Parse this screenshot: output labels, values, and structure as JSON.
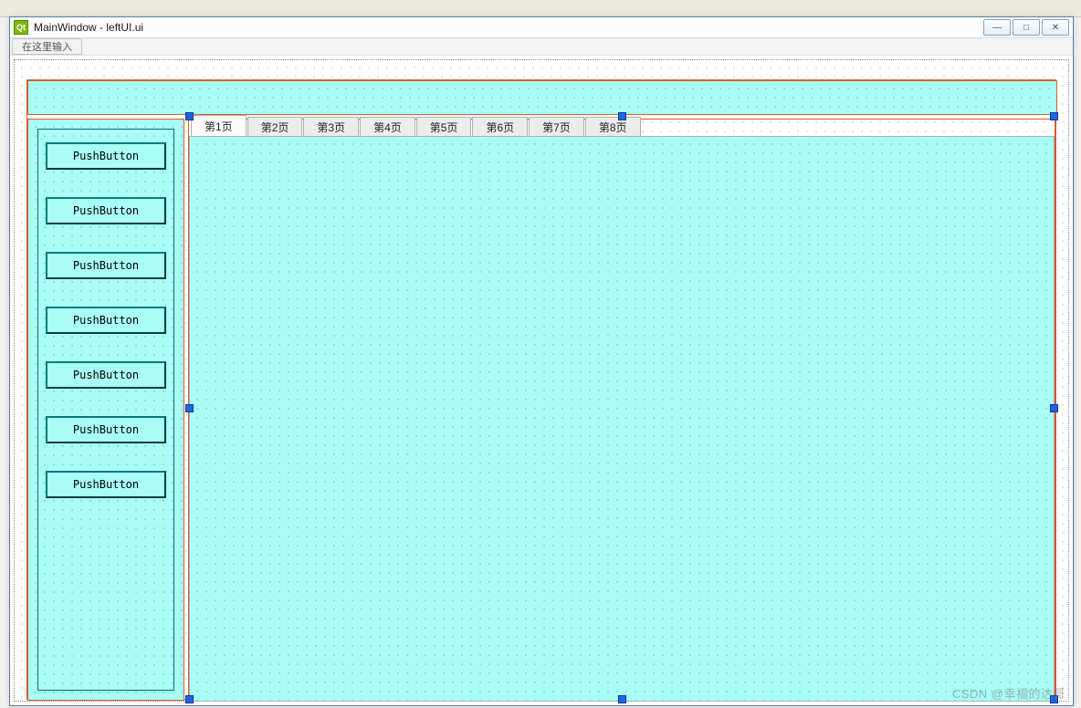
{
  "window": {
    "title": "MainWindow - leftUI.ui",
    "icon_label": "Qt",
    "minimize_glyph": "—",
    "maximize_glyph": "□",
    "close_glyph": "✕"
  },
  "menu": {
    "placeholder": "在这里输入"
  },
  "sidebar": {
    "buttons": [
      {
        "label": "PushButton"
      },
      {
        "label": "PushButton"
      },
      {
        "label": "PushButton"
      },
      {
        "label": "PushButton"
      },
      {
        "label": "PushButton"
      },
      {
        "label": "PushButton"
      },
      {
        "label": "PushButton"
      }
    ]
  },
  "tabs": [
    {
      "label": "第1页",
      "active": true
    },
    {
      "label": "第2页",
      "active": false
    },
    {
      "label": "第3页",
      "active": false
    },
    {
      "label": "第4页",
      "active": false
    },
    {
      "label": "第5页",
      "active": false
    },
    {
      "label": "第6页",
      "active": false
    },
    {
      "label": "第7页",
      "active": false
    },
    {
      "label": "第8页",
      "active": false
    }
  ],
  "watermark": "CSDN @幸福的达哥"
}
